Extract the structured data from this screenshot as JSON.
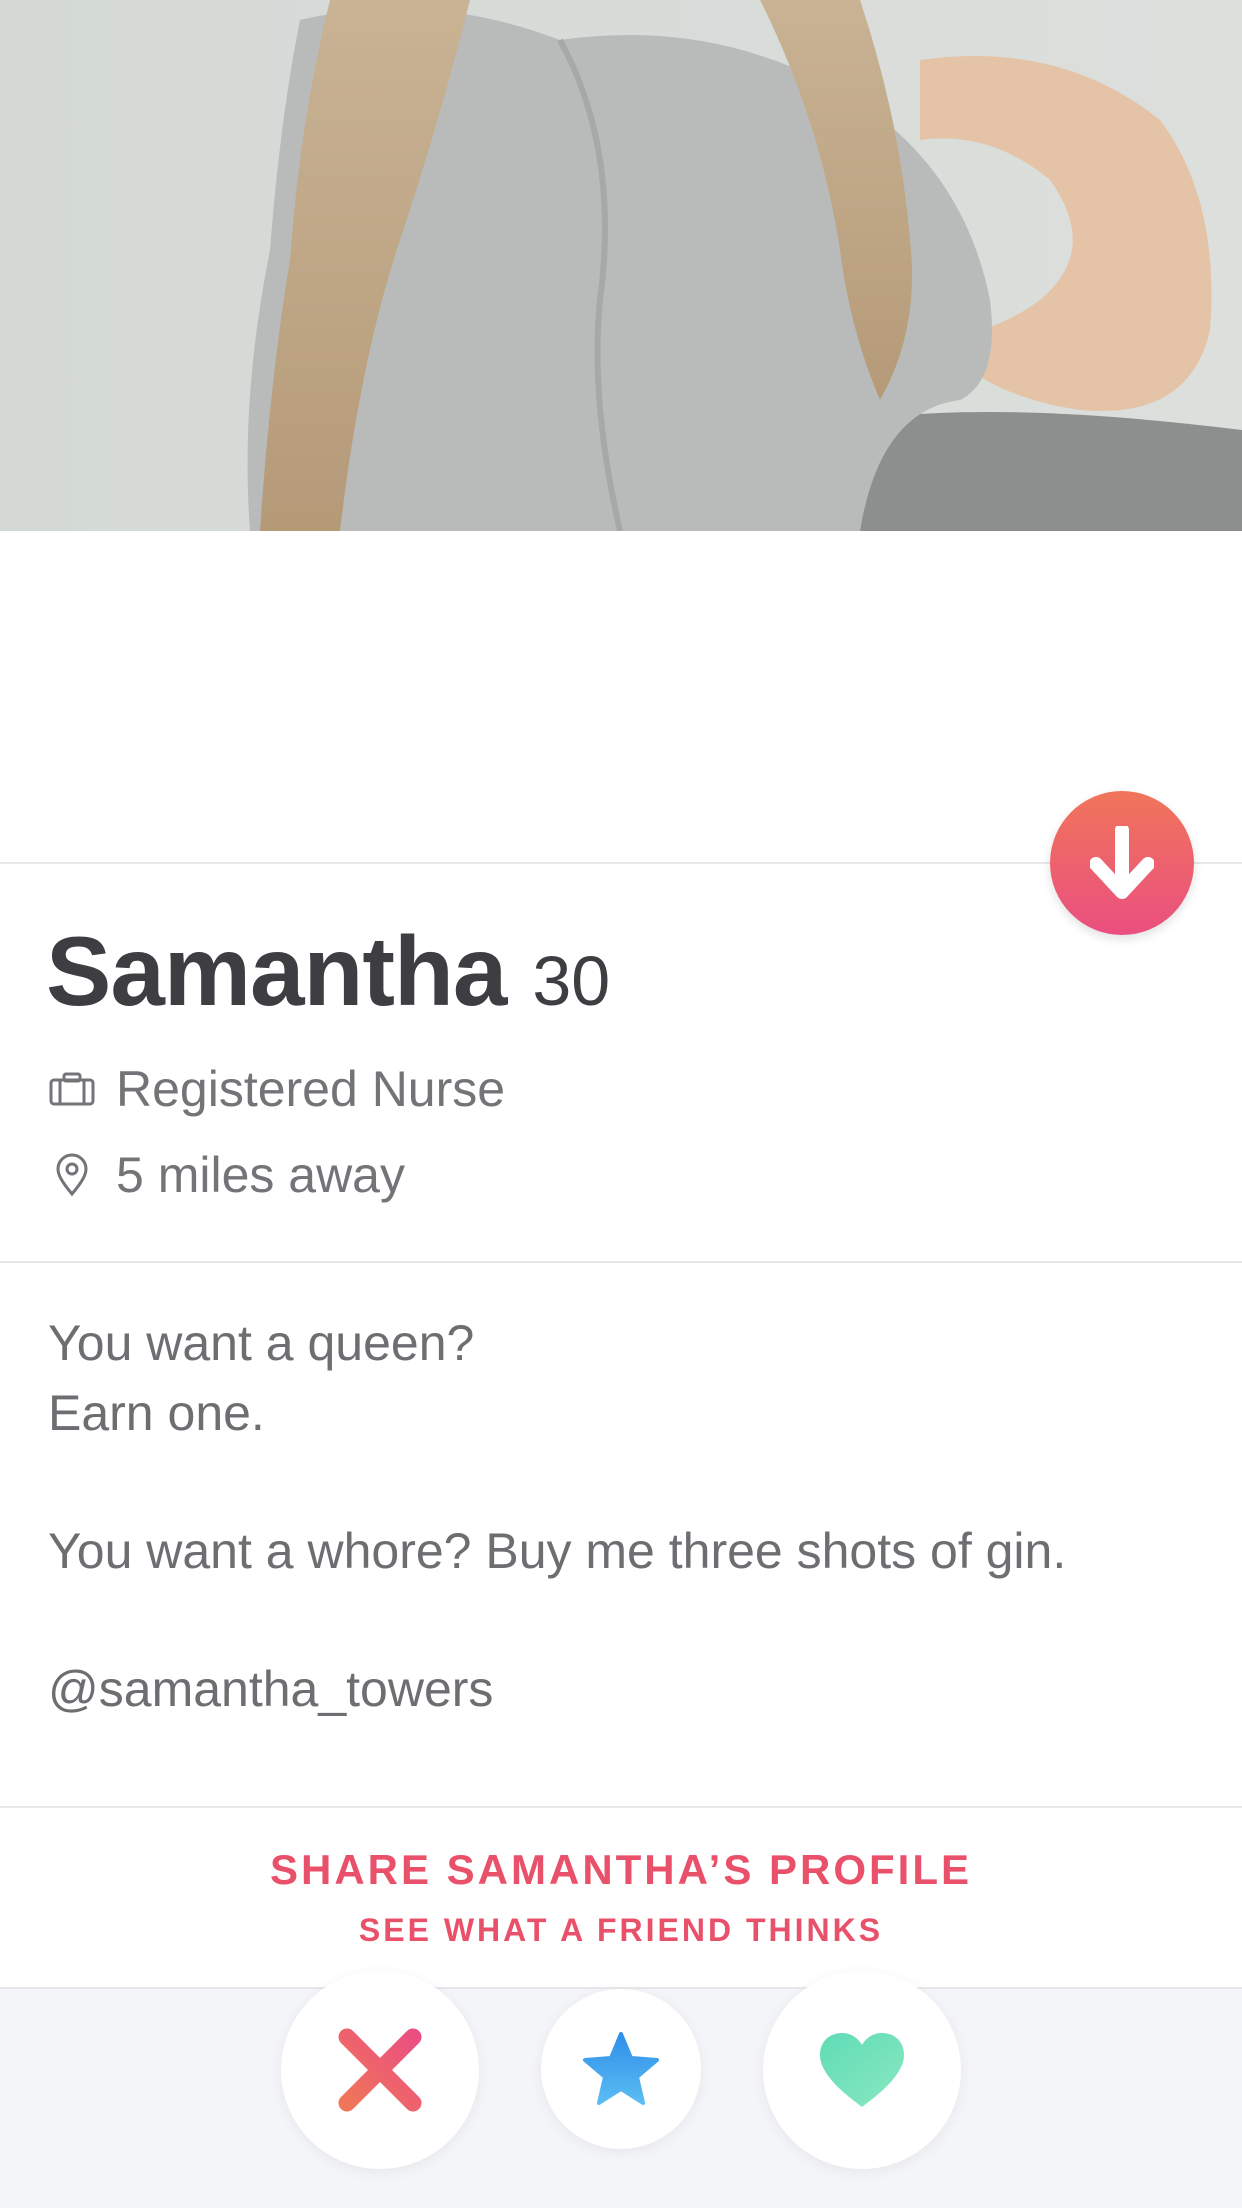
{
  "profile": {
    "name": "Samantha",
    "age": "30",
    "job": "Registered Nurse",
    "distance": "5 miles away"
  },
  "bio": {
    "lines": [
      "You want a queen?",
      "Earn one.",
      "",
      "You want a whore? Buy me three shots of gin.",
      "",
      "@samantha_towers"
    ]
  },
  "share": {
    "title": "SHARE SAMANTHA’S PROFILE",
    "subtitle": "SEE WHAT A FRIEND THINKS"
  },
  "icons": {
    "collapse": "arrow-down-icon",
    "job": "briefcase-icon",
    "location": "location-pin-icon",
    "nope": "nope-x-icon",
    "super_like": "star-icon",
    "like": "heart-icon"
  },
  "colors": {
    "accent_pink": "#e9506a",
    "nope_start": "#f0755a",
    "nope_end": "#ea4f80",
    "super_like": "#4aa8f0",
    "like": "#6ee3b5",
    "text_dark": "#3e3e42",
    "text_gray": "#747478"
  }
}
